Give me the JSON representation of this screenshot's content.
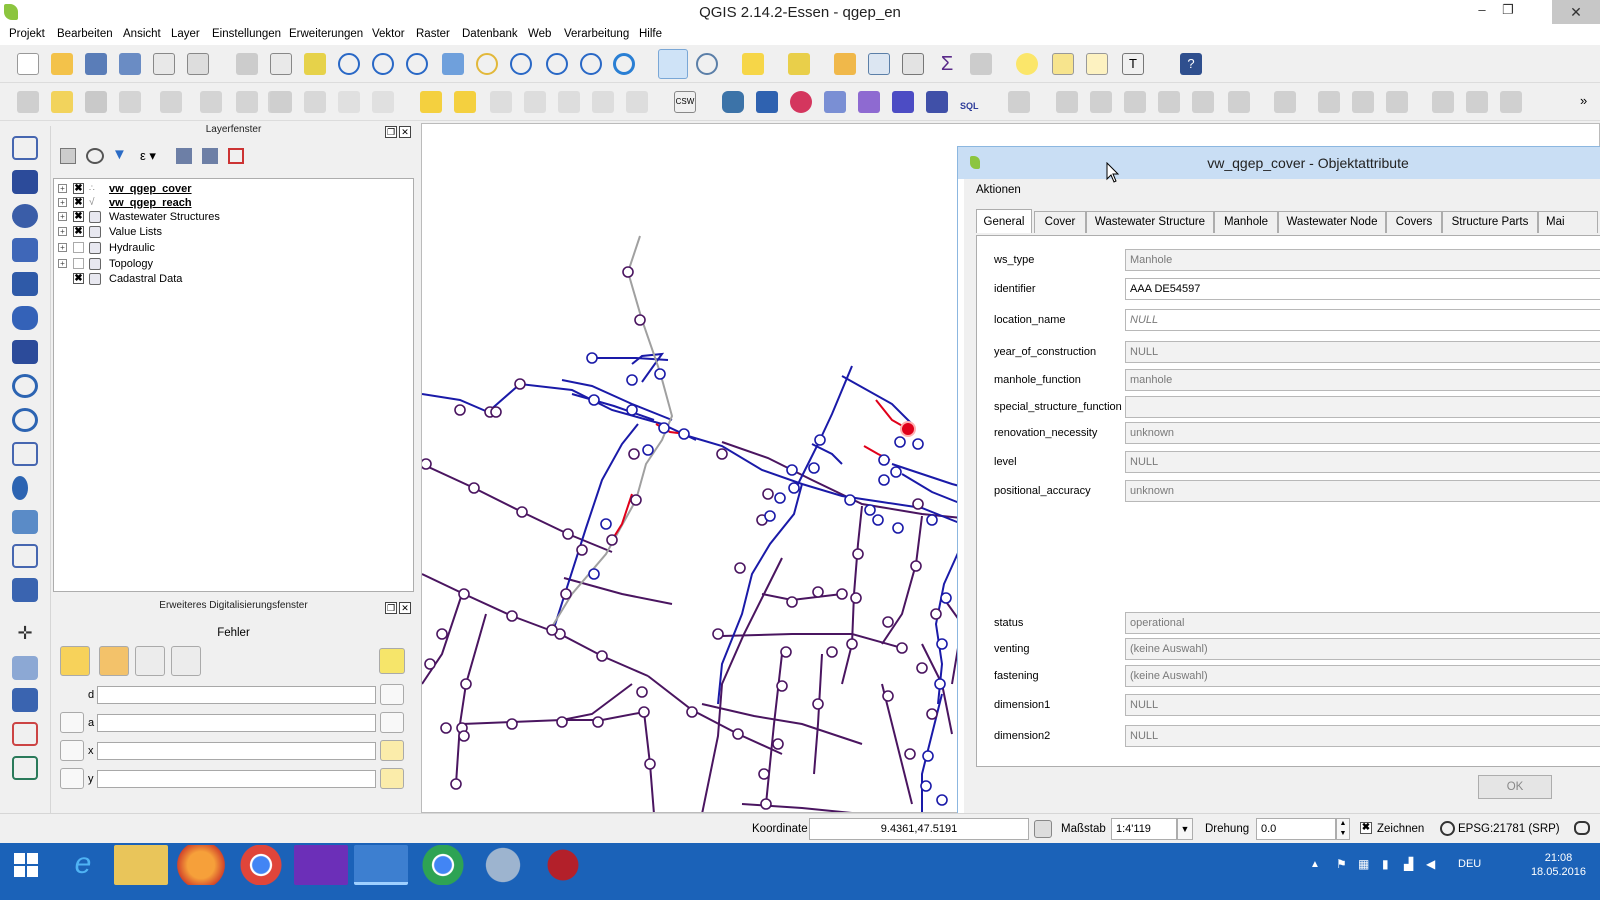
{
  "window": {
    "title": "QGIS 2.14.2-Essen - qgep_en"
  },
  "menu": [
    "Projekt",
    "Bearbeiten",
    "Ansicht",
    "Layer",
    "Einstellungen",
    "Erweiterungen",
    "Vektor",
    "Raster",
    "Datenbank",
    "Web",
    "Verarbeitung",
    "Hilfe"
  ],
  "layer_panel": {
    "title": "Layerfenster",
    "layers": [
      {
        "name": "vw_qgep_cover",
        "checked": "✖",
        "bold": true
      },
      {
        "name": "vw_qgep_reach",
        "checked": "✖",
        "bold": true
      },
      {
        "name": "Wastewater Structures",
        "checked": "✖",
        "bold": false
      },
      {
        "name": "Value Lists",
        "checked": "✖",
        "bold": false
      },
      {
        "name": "Hydraulic",
        "checked": "",
        "bold": false
      },
      {
        "name": "Topology",
        "checked": "",
        "bold": false
      },
      {
        "name": "Cadastral Data",
        "checked": "✖",
        "bold": false
      }
    ]
  },
  "digitizing_panel": {
    "title": "Erweiteres Digitalisierungsfenster",
    "error_label": "Fehler",
    "fields": [
      {
        "label": "d"
      },
      {
        "label": "a"
      },
      {
        "label": "x"
      },
      {
        "label": "y"
      }
    ]
  },
  "dialog": {
    "title": "vw_qgep_cover - Objektattribute",
    "actions_label": "Aktionen",
    "tabs": [
      "General",
      "Cover",
      "Wastewater Structure",
      "Manhole",
      "Wastewater Node",
      "Covers",
      "Structure Parts",
      "Mai"
    ],
    "fields": [
      {
        "label": "ws_type",
        "value": "Manhole"
      },
      {
        "label": "identifier",
        "value": "AAA DE54597"
      },
      {
        "label": "location_name",
        "value": "NULL"
      },
      {
        "label": "year_of_construction",
        "value": "NULL"
      },
      {
        "label": "manhole_function",
        "value": "manhole"
      },
      {
        "label": "special_structure_function",
        "value": ""
      },
      {
        "label": "renovation_necessity",
        "value": "unknown"
      },
      {
        "label": "level",
        "value": "NULL"
      },
      {
        "label": "positional_accuracy",
        "value": "unknown"
      },
      {
        "label": "status",
        "value": "operational"
      },
      {
        "label": "venting",
        "value": "(keine Auswahl)"
      },
      {
        "label": "fastening",
        "value": "(keine Auswahl)"
      },
      {
        "label": "dimension1",
        "value": "NULL"
      },
      {
        "label": "dimension2",
        "value": "NULL"
      }
    ],
    "ok_label": "OK"
  },
  "statusbar": {
    "coord_label": "Koordinate",
    "coord_value": "9.4361,47.5191",
    "scale_label": "Maßstab",
    "scale_value": "1:4'119",
    "rotation_label": "Drehung",
    "rotation_value": "0.0",
    "render_check": "✖",
    "render_label": "Zeichnen",
    "crs": "EPSG:21781 (SRP)"
  },
  "taskbar": {
    "lang": "DEU",
    "time": "21:08",
    "date": "18.05.2016"
  },
  "colors": {
    "network_blue": "#1a1aa8",
    "network_purple": "#4a1560",
    "selected_red": "#e0001a",
    "gray_line": "#a0a0a0"
  }
}
